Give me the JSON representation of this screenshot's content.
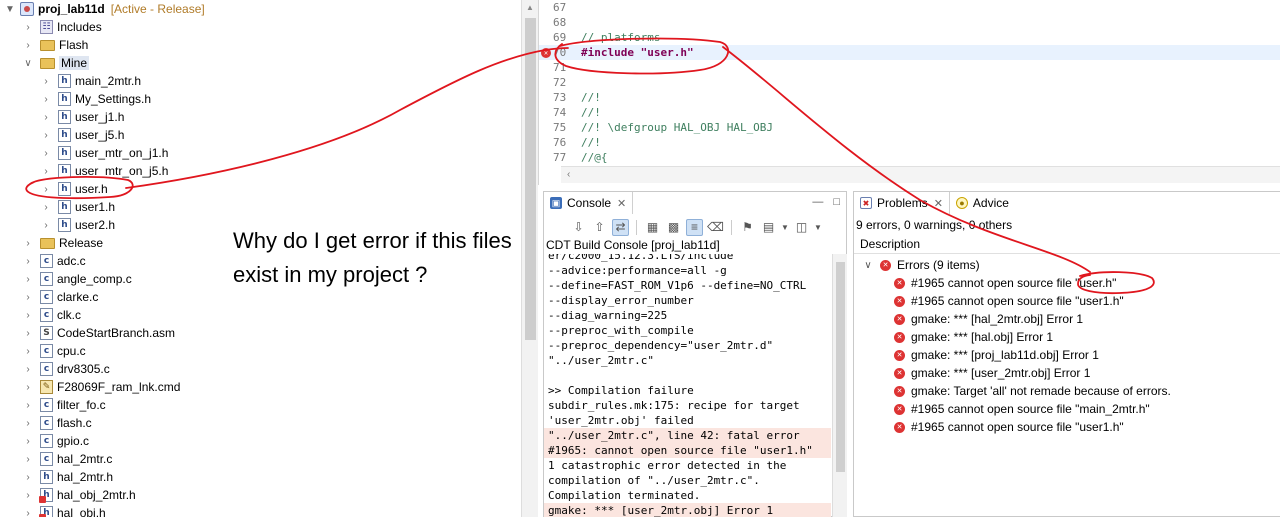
{
  "explorer": {
    "project_name": "proj_lab11d",
    "project_status": "[Active - Release]",
    "items": [
      {
        "label": "Includes",
        "icon": "includes-icon",
        "depth": 1,
        "expanded": false,
        "kind": "includes"
      },
      {
        "label": "Flash",
        "icon": "folder-icon",
        "depth": 1,
        "expanded": false,
        "kind": "folder"
      },
      {
        "label": "Mine",
        "icon": "folder-icon",
        "depth": 1,
        "expanded": true,
        "kind": "folder",
        "selected": true
      },
      {
        "label": "main_2mtr.h",
        "icon": "header-file-icon",
        "depth": 2,
        "expanded": false,
        "kind": "h"
      },
      {
        "label": "My_Settings.h",
        "icon": "header-file-icon",
        "depth": 2,
        "expanded": false,
        "kind": "h"
      },
      {
        "label": "user_j1.h",
        "icon": "header-file-icon",
        "depth": 2,
        "expanded": false,
        "kind": "h"
      },
      {
        "label": "user_j5.h",
        "icon": "header-file-icon",
        "depth": 2,
        "expanded": false,
        "kind": "h"
      },
      {
        "label": "user_mtr_on_j1.h",
        "icon": "header-file-icon",
        "depth": 2,
        "expanded": false,
        "kind": "h"
      },
      {
        "label": "user_mtr_on_j5.h",
        "icon": "header-file-icon",
        "depth": 2,
        "expanded": false,
        "kind": "h"
      },
      {
        "label": "user.h",
        "icon": "header-file-icon",
        "depth": 2,
        "expanded": false,
        "kind": "h"
      },
      {
        "label": "user1.h",
        "icon": "header-file-icon",
        "depth": 2,
        "expanded": false,
        "kind": "h"
      },
      {
        "label": "user2.h",
        "icon": "header-file-icon",
        "depth": 2,
        "expanded": false,
        "kind": "h"
      },
      {
        "label": "Release",
        "icon": "folder-icon",
        "depth": 1,
        "expanded": false,
        "kind": "folder"
      },
      {
        "label": "adc.c",
        "icon": "c-file-icon",
        "depth": 1,
        "expanded": false,
        "kind": "c"
      },
      {
        "label": "angle_comp.c",
        "icon": "c-file-icon",
        "depth": 1,
        "expanded": false,
        "kind": "c"
      },
      {
        "label": "clarke.c",
        "icon": "c-file-icon",
        "depth": 1,
        "expanded": false,
        "kind": "c"
      },
      {
        "label": "clk.c",
        "icon": "c-file-icon",
        "depth": 1,
        "expanded": false,
        "kind": "c"
      },
      {
        "label": "CodeStartBranch.asm",
        "icon": "asm-file-icon",
        "depth": 1,
        "expanded": false,
        "kind": "asm"
      },
      {
        "label": "cpu.c",
        "icon": "c-file-icon",
        "depth": 1,
        "expanded": false,
        "kind": "c"
      },
      {
        "label": "drv8305.c",
        "icon": "c-file-icon",
        "depth": 1,
        "expanded": false,
        "kind": "c"
      },
      {
        "label": "F28069F_ram_lnk.cmd",
        "icon": "cmd-file-icon",
        "depth": 1,
        "expanded": false,
        "kind": "cmd"
      },
      {
        "label": "filter_fo.c",
        "icon": "c-file-icon",
        "depth": 1,
        "expanded": false,
        "kind": "c"
      },
      {
        "label": "flash.c",
        "icon": "c-file-icon",
        "depth": 1,
        "expanded": false,
        "kind": "c"
      },
      {
        "label": "gpio.c",
        "icon": "c-file-icon",
        "depth": 1,
        "expanded": false,
        "kind": "c"
      },
      {
        "label": "hal_2mtr.c",
        "icon": "c-file-icon",
        "depth": 1,
        "expanded": false,
        "kind": "c"
      },
      {
        "label": "hal_2mtr.h",
        "icon": "header-file-icon",
        "depth": 1,
        "expanded": false,
        "kind": "h"
      },
      {
        "label": "hal_obj_2mtr.h",
        "icon": "header-file-error-icon",
        "depth": 1,
        "expanded": false,
        "kind": "h-err"
      },
      {
        "label": "hal_obj.h",
        "icon": "header-file-error-icon",
        "depth": 1,
        "expanded": false,
        "kind": "h-err"
      }
    ]
  },
  "question": "Why do I get error if this files exist in my project ?",
  "editor": {
    "lines": [
      {
        "num": "67",
        "text": "",
        "kind": "plain"
      },
      {
        "num": "68",
        "text": "",
        "kind": "plain"
      },
      {
        "num": "69",
        "text": "// platforms",
        "kind": "comment"
      },
      {
        "num": "70",
        "text": "#include \"user.h\"",
        "kind": "include",
        "error": true,
        "highlight": true
      },
      {
        "num": "71",
        "text": "",
        "kind": "plain"
      },
      {
        "num": "72",
        "text": "",
        "kind": "plain"
      },
      {
        "num": "73",
        "text": "//!",
        "kind": "comment"
      },
      {
        "num": "74",
        "text": "//!",
        "kind": "comment"
      },
      {
        "num": "75",
        "text": "//! \\defgroup HAL_OBJ HAL_OBJ",
        "kind": "comment"
      },
      {
        "num": "76",
        "text": "//!",
        "kind": "comment"
      },
      {
        "num": "77",
        "text": "//@{",
        "kind": "comment"
      }
    ]
  },
  "console": {
    "tab_label": "Console",
    "title": "CDT Build Console [proj_lab11d]",
    "lines": [
      {
        "text": "er/c2000_15.12.3.LTS/include",
        "error": false
      },
      {
        "text": "--advice:performance=all -g",
        "error": false
      },
      {
        "text": "--define=FAST_ROM_V1p6 --define=NO_CTRL",
        "error": false
      },
      {
        "text": "--display_error_number",
        "error": false
      },
      {
        "text": "--diag_warning=225",
        "error": false
      },
      {
        "text": "--preproc_with_compile",
        "error": false
      },
      {
        "text": "--preproc_dependency=\"user_2mtr.d\"",
        "error": false
      },
      {
        "text": "\"../user_2mtr.c\"",
        "error": false
      },
      {
        "text": "",
        "error": false
      },
      {
        "text": ">> Compilation failure",
        "error": false
      },
      {
        "text": "subdir_rules.mk:175: recipe for target",
        "error": false
      },
      {
        "text": "'user_2mtr.obj' failed",
        "error": false
      },
      {
        "text": "\"../user_2mtr.c\", line 42: fatal error",
        "error": true
      },
      {
        "text": "#1965: cannot open source file \"user1.h\"",
        "error": true
      },
      {
        "text": "1 catastrophic error detected in the",
        "error": false
      },
      {
        "text": "compilation of \"../user_2mtr.c\".",
        "error": false
      },
      {
        "text": "Compilation terminated.",
        "error": false
      },
      {
        "text": "gmake: *** [user_2mtr.obj] Error 1",
        "error": true
      }
    ]
  },
  "problems": {
    "tab_label": "Problems",
    "advice_label": "Advice",
    "summary": "9 errors, 0 warnings, 0 others",
    "column_header": "Description",
    "group_label": "Errors (9 items)",
    "items": [
      "#1965 cannot open source file \"user.h\"",
      "#1965 cannot open source file \"user1.h\"",
      "gmake: *** [hal_2mtr.obj] Error 1",
      "gmake: *** [hal.obj] Error 1",
      "gmake: *** [proj_lab11d.obj] Error 1",
      "gmake: *** [user_2mtr.obj] Error 1",
      "gmake: Target 'all' not remade because of errors.",
      "#1965 cannot open source file \"main_2mtr.h\"",
      "#1965 cannot open source file \"user1.h\""
    ]
  },
  "colors": {
    "annotation": "#e0161e",
    "error": "#d33333",
    "highlight": "#e8f2fe",
    "console_error_bg": "#fbe5df",
    "project_status": "#b07b28"
  }
}
